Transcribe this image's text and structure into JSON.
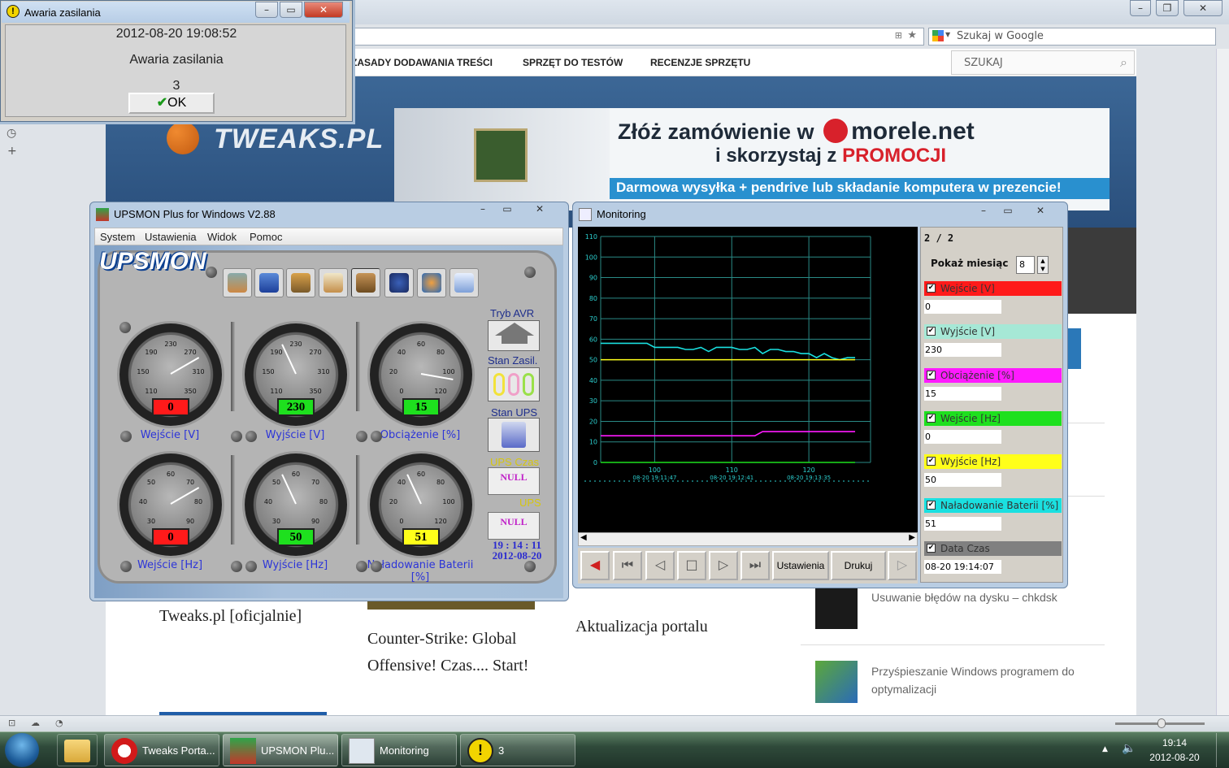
{
  "browser": {
    "search_placeholder": "Szukaj w Google",
    "nav": [
      "ZASADY DODAWANIA TREŚCI",
      "SPRZĘT DO TESTÓW",
      "RECENZJE SPRZĘTU"
    ],
    "site_search": "SZUKAJ",
    "logo": "TWEAKS.PL",
    "ad": {
      "line1_prefix": "Złóż zamówienie w",
      "brand": "morele.net",
      "line2_prefix": "i skorzystaj z",
      "line2_bold": "PROMOCJI",
      "banner": "Darmowa wysyłka + pendrive lub składanie komputera w prezencie!"
    },
    "articles": [
      "Tweaks.pl [oficjalnie]",
      "Counter-Strike: Global Offensive! Czas.... Start!",
      "Aktualizacja portalu"
    ],
    "sidebar_items": [
      "Usuwanie błędów na dysku – chkdsk",
      "Przyśpieszanie Windows programem do optymalizacji"
    ]
  },
  "dialog": {
    "title": "Awaria zasilania",
    "datetime": "2012-08-20 19:08:52",
    "message": "Awaria zasilania",
    "code": "3",
    "ok": "OK"
  },
  "upsmon": {
    "title": "UPSMON Plus for Windows V2.88",
    "menu": [
      "System",
      "Ustawienia",
      "Widok",
      "Pomoc"
    ],
    "logo": "UPSMON",
    "gauges": [
      {
        "label": "Wejście [V]",
        "value": "0",
        "color": "#ff1a1a",
        "ticks": [
          "110",
          "150",
          "190",
          "230",
          "270",
          "310",
          "350"
        ]
      },
      {
        "label": "Wyjście [V]",
        "value": "230",
        "color": "#1ee01e",
        "ticks": [
          "110",
          "150",
          "190",
          "230",
          "270",
          "310",
          "350"
        ]
      },
      {
        "label": "Obciążenie [%]",
        "value": "15",
        "color": "#1ee01e",
        "ticks": [
          "0",
          "20",
          "40",
          "60",
          "80",
          "100",
          "120"
        ]
      },
      {
        "label": "Wejście [Hz]",
        "value": "0",
        "color": "#ff1a1a",
        "ticks": [
          "30",
          "40",
          "50",
          "60",
          "70",
          "80",
          "90"
        ]
      },
      {
        "label": "Wyjście [Hz]",
        "value": "50",
        "color": "#1ee01e",
        "ticks": [
          "30",
          "40",
          "50",
          "60",
          "70",
          "80",
          "90"
        ]
      },
      {
        "label": "Naładowanie Baterii [%]",
        "value": "51",
        "color": "#ffff1a",
        "ticks": [
          "0",
          "20",
          "40",
          "60",
          "80",
          "100",
          "120"
        ]
      }
    ],
    "side": {
      "avr": "Tryb AVR",
      "power": "Stan Zasil.",
      "ups_state": "Stan UPS",
      "ups_time": "UPS Czas",
      "null1": "NULL",
      "ups": "UPS",
      "null2": "NULL",
      "time": "19 : 14 : 11",
      "date": "2012-08-20"
    }
  },
  "monitoring": {
    "title": "Monitoring",
    "page": "2 / 2",
    "month_label": "Pokaż miesiąc",
    "month_value": "8",
    "controls": {
      "settings": "Ustawienia",
      "print": "Drukuj"
    },
    "legend": [
      {
        "name": "Wejście [V]",
        "color": "#ff1a1a",
        "value": "0"
      },
      {
        "name": "Wyjście [V]",
        "color": "#a6e8d6",
        "value": "230"
      },
      {
        "name": "Obciążenie [%]",
        "color": "#ff1aff",
        "value": "15"
      },
      {
        "name": "Wejście [Hz]",
        "color": "#1ee01e",
        "value": "0"
      },
      {
        "name": "Wyjście [Hz]",
        "color": "#ffff1a",
        "value": "50"
      },
      {
        "name": "Naładowanie Baterii [%]",
        "color": "#1ae0e0",
        "value": "51"
      },
      {
        "name": "Data Czas",
        "color": "#808080",
        "value": "08-20 19:14:07"
      }
    ]
  },
  "chart_data": {
    "type": "line",
    "ylim": [
      0,
      110
    ],
    "yticks": [
      "0",
      "10",
      "20",
      "30",
      "40",
      "50",
      "60",
      "70",
      "80",
      "90",
      "100",
      "110"
    ],
    "x_ticks": [
      {
        "x": 100,
        "label": "100",
        "time": "08-20 19:11:47"
      },
      {
        "x": 110,
        "label": "110",
        "time": "08-20 19:12:41"
      },
      {
        "x": 120,
        "label": "120",
        "time": "08-20 19:13:35"
      }
    ],
    "xlim": [
      93,
      128
    ],
    "x": [
      93,
      94,
      95,
      96,
      97,
      98,
      99,
      100,
      101,
      102,
      103,
      104,
      105,
      106,
      107,
      108,
      109,
      110,
      111,
      112,
      113,
      114,
      115,
      116,
      117,
      118,
      119,
      120,
      121,
      122,
      123,
      124,
      125,
      126
    ],
    "series": [
      {
        "name": "Naładowanie Baterii [%]",
        "color": "#1ae0e0",
        "values": [
          58,
          58,
          58,
          58,
          58,
          58,
          58,
          56,
          56,
          56,
          56,
          55,
          55,
          56,
          54,
          56,
          56,
          56,
          55,
          55,
          56,
          53,
          55,
          55,
          54,
          54,
          53,
          53,
          51,
          53,
          51,
          50,
          51,
          51
        ]
      },
      {
        "name": "Wyjście [Hz]",
        "color": "#ffff1a",
        "values": [
          50,
          50,
          50,
          50,
          50,
          50,
          50,
          50,
          50,
          50,
          50,
          50,
          50,
          50,
          50,
          50,
          50,
          50,
          50,
          50,
          50,
          50,
          50,
          50,
          50,
          50,
          50,
          50,
          50,
          50,
          50,
          50,
          50,
          50
        ]
      },
      {
        "name": "Obciążenie [%]",
        "color": "#ff1aff",
        "values": [
          13,
          13,
          13,
          13,
          13,
          13,
          13,
          13,
          13,
          13,
          13,
          13,
          13,
          13,
          13,
          13,
          13,
          13,
          13,
          13,
          13,
          15,
          15,
          15,
          15,
          15,
          15,
          15,
          15,
          15,
          15,
          15,
          15,
          15
        ]
      },
      {
        "name": "Wejście [Hz]",
        "color": "#1ee01e",
        "values": [
          0,
          0,
          0,
          0,
          0,
          0,
          0,
          0,
          0,
          0,
          0,
          0,
          0,
          0,
          0,
          0,
          0,
          0,
          0,
          0,
          0,
          0,
          0,
          0,
          0,
          0,
          0,
          0,
          0,
          0,
          0,
          0,
          0,
          0
        ]
      }
    ]
  },
  "taskbar": {
    "items": [
      "Tweaks Porta...",
      "UPSMON Plu...",
      "Monitoring",
      "3"
    ],
    "time": "19:14",
    "date": "2012-08-20"
  }
}
